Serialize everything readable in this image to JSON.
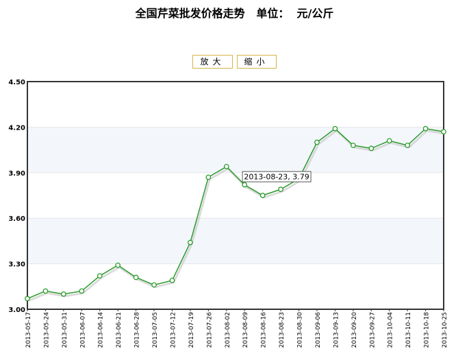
{
  "page": {
    "title": "全国芹菜批发价格走势   单位：  元/公斤"
  },
  "controls": {
    "zoom_in_label": "放大",
    "zoom_out_label": "缩小"
  },
  "colors": {
    "line": "#2a9a2a",
    "band": "#f3f7fc",
    "shadow": "#cccccc",
    "grid": "#e6e6e6"
  },
  "tooltip": {
    "text": "2013-08-23, 3.79"
  },
  "chart_data": {
    "type": "line",
    "x": [
      "2013-05-17",
      "2013-05-24",
      "2013-05-31",
      "2013-06-07",
      "2013-06-14",
      "2013-06-21",
      "2013-06-28",
      "2013-07-05",
      "2013-07-12",
      "2013-07-19",
      "2013-07-26",
      "2013-08-02",
      "2013-08-09",
      "2013-08-16",
      "2013-08-23",
      "2013-08-30",
      "2013-09-06",
      "2013-09-13",
      "2013-09-20",
      "2013-09-27",
      "2013-10-04",
      "2013-10-11",
      "2013-10-18",
      "2013-10-25"
    ],
    "values": [
      3.07,
      3.12,
      3.1,
      3.12,
      3.22,
      3.29,
      3.21,
      3.16,
      3.19,
      3.44,
      3.87,
      3.94,
      3.82,
      3.75,
      3.79,
      3.86,
      4.1,
      4.19,
      4.08,
      4.06,
      4.11,
      4.08,
      4.19,
      4.17
    ],
    "ylim": [
      3.0,
      4.5
    ],
    "yticks": [
      "3.00",
      "3.30",
      "3.60",
      "3.90",
      "4.20",
      "4.50"
    ],
    "grid": true
  }
}
